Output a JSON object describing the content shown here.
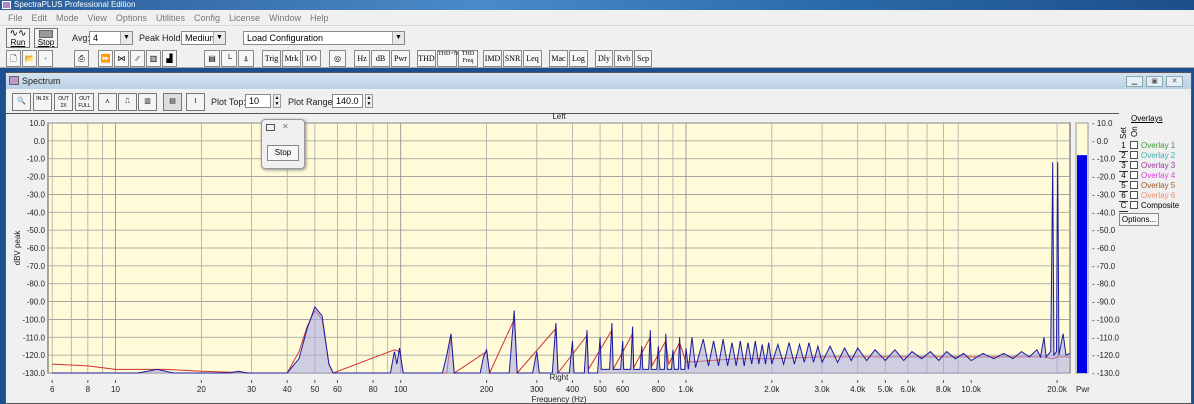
{
  "app": {
    "title": "SpectraPLUS Professional Edition"
  },
  "menu": [
    "File",
    "Edit",
    "Mode",
    "View",
    "Options",
    "Utilities",
    "Config",
    "License",
    "Window",
    "Help"
  ],
  "toolbar": {
    "run_label": "Run",
    "stop_label": "Stop",
    "avg_label": "Avg:",
    "avg_value": "4",
    "peak_hold_label": "Peak Hold:",
    "peak_hold_value": "Medium",
    "config_value": "Load Configuration"
  },
  "toolbar2": {
    "text_buttons": [
      "Trig",
      "Mrk",
      "I/O",
      "Hz",
      "dB",
      "Pwr",
      "THD",
      "THD+N",
      "THD Freq",
      "IMD",
      "SNR",
      "Leq",
      "Mac",
      "Log",
      "Dly",
      "Rvb",
      "Scp"
    ]
  },
  "spectrum_window": {
    "title": "Spectrum",
    "zoom_buttons": [
      "IN 2X",
      "OUT 2X",
      "OUT FULL"
    ],
    "plot_top_label": "Plot Top:",
    "plot_top_value": "10",
    "plot_range_label": "Plot Range:",
    "plot_range_value": "140.0"
  },
  "popup": {
    "stop_label": "Stop"
  },
  "overlays": {
    "title": "Overlays",
    "set_label": "Set",
    "on_label": "On",
    "items": [
      {
        "key": "1",
        "label": "Overlay 1",
        "color": "#3a9a3a"
      },
      {
        "key": "2",
        "label": "Overlay 2",
        "color": "#3ab0b0"
      },
      {
        "key": "3",
        "label": "Overlay 3",
        "color": "#9a3aa0"
      },
      {
        "key": "4",
        "label": "Overlay 4",
        "color": "#e040e0"
      },
      {
        "key": "5",
        "label": "Overlay 5",
        "color": "#9a5a2a"
      },
      {
        "key": "6",
        "label": "Overlay 6",
        "color": "#f0906a"
      },
      {
        "key": "C",
        "label": "Composite",
        "color": "#000000"
      }
    ],
    "options_label": "Options..."
  },
  "chart_data": {
    "type": "line",
    "top_label": "Left",
    "bottom_label": "Right",
    "xlabel": "Frequency (Hz)",
    "ylabel": "dBV peak",
    "xscale": "log",
    "xlim": [
      5.8,
      22200
    ],
    "ylim": [
      -130,
      10
    ],
    "grid": true,
    "yticks": [
      "10.0",
      "0.0",
      "-10.0",
      "-20.0",
      "-30.0",
      "-40.0",
      "-50.0",
      "-60.0",
      "-70.0",
      "-80.0",
      "-90.0",
      "-100.0",
      "-110.0",
      "-120.0",
      "-130.0"
    ],
    "xticks": [
      {
        "v": 6,
        "l": "6"
      },
      {
        "v": 8,
        "l": "8"
      },
      {
        "v": 10,
        "l": "10"
      },
      {
        "v": 20,
        "l": "20"
      },
      {
        "v": 30,
        "l": "30"
      },
      {
        "v": 40,
        "l": "40"
      },
      {
        "v": 50,
        "l": "50"
      },
      {
        "v": 60,
        "l": "60"
      },
      {
        "v": 80,
        "l": "80"
      },
      {
        "v": 100,
        "l": "100"
      },
      {
        "v": 200,
        "l": "200"
      },
      {
        "v": 300,
        "l": "300"
      },
      {
        "v": 400,
        "l": "400"
      },
      {
        "v": 500,
        "l": "500"
      },
      {
        "v": 600,
        "l": "600"
      },
      {
        "v": 800,
        "l": "800"
      },
      {
        "v": 1000,
        "l": "1.0k"
      },
      {
        "v": 2000,
        "l": "2.0k"
      },
      {
        "v": 3000,
        "l": "3.0k"
      },
      {
        "v": 4000,
        "l": "4.0k"
      },
      {
        "v": 5000,
        "l": "5.0k"
      },
      {
        "v": 6000,
        "l": "6.0k"
      },
      {
        "v": 8000,
        "l": "8.0k"
      },
      {
        "v": 10000,
        "l": "10.0k"
      },
      {
        "v": 20000,
        "l": "20.0k"
      }
    ],
    "series": [
      {
        "color": "#1a1aa0",
        "points": [
          [
            6,
            -130
          ],
          [
            12,
            -130
          ],
          [
            14,
            -128
          ],
          [
            16,
            -130
          ],
          [
            25,
            -130
          ],
          [
            27,
            -129
          ],
          [
            29,
            -130
          ],
          [
            40,
            -130
          ],
          [
            44,
            -122
          ],
          [
            47,
            -105
          ],
          [
            50,
            -93
          ],
          [
            53,
            -98
          ],
          [
            56,
            -125
          ],
          [
            58,
            -130
          ],
          [
            92,
            -130
          ],
          [
            95,
            -118
          ],
          [
            97,
            -125
          ],
          [
            99,
            -116
          ],
          [
            102,
            -130
          ],
          [
            140,
            -130
          ],
          [
            145,
            -120
          ],
          [
            150,
            -108
          ],
          [
            154,
            -130
          ],
          [
            190,
            -130
          ],
          [
            195,
            -121
          ],
          [
            200,
            -117
          ],
          [
            205,
            -130
          ],
          [
            240,
            -130
          ],
          [
            250,
            -95
          ],
          [
            256,
            -130
          ],
          [
            290,
            -130
          ],
          [
            300,
            -118
          ],
          [
            306,
            -130
          ],
          [
            340,
            -130
          ],
          [
            350,
            -102
          ],
          [
            356,
            -130
          ],
          [
            390,
            -130
          ],
          [
            400,
            -112
          ],
          [
            405,
            -130
          ],
          [
            440,
            -130
          ],
          [
            450,
            -106
          ],
          [
            455,
            -130
          ],
          [
            490,
            -130
          ],
          [
            500,
            -110
          ],
          [
            505,
            -128
          ],
          [
            540,
            -128
          ],
          [
            550,
            -102
          ],
          [
            556,
            -128
          ],
          [
            590,
            -128
          ],
          [
            600,
            -112
          ],
          [
            605,
            -128
          ],
          [
            640,
            -128
          ],
          [
            650,
            -104
          ],
          [
            656,
            -128
          ],
          [
            690,
            -128
          ],
          [
            700,
            -115
          ],
          [
            706,
            -128
          ],
          [
            740,
            -128
          ],
          [
            750,
            -106
          ],
          [
            756,
            -128
          ],
          [
            790,
            -128
          ],
          [
            800,
            -115
          ],
          [
            810,
            -128
          ],
          [
            840,
            -128
          ],
          [
            850,
            -108
          ],
          [
            860,
            -128
          ],
          [
            890,
            -128
          ],
          [
            900,
            -117
          ],
          [
            910,
            -128
          ],
          [
            940,
            -128
          ],
          [
            950,
            -110
          ],
          [
            960,
            -128
          ],
          [
            990,
            -128
          ],
          [
            1000,
            -116
          ],
          [
            1020,
            -128
          ],
          [
            1050,
            -110
          ],
          [
            1080,
            -127
          ],
          [
            1150,
            -111
          ],
          [
            1200,
            -126
          ],
          [
            1250,
            -112
          ],
          [
            1300,
            -126
          ],
          [
            1350,
            -111
          ],
          [
            1400,
            -126
          ],
          [
            1450,
            -113
          ],
          [
            1500,
            -126
          ],
          [
            1550,
            -112
          ],
          [
            1600,
            -126
          ],
          [
            1650,
            -113
          ],
          [
            1700,
            -125
          ],
          [
            1750,
            -112
          ],
          [
            1800,
            -125
          ],
          [
            1850,
            -114
          ],
          [
            1900,
            -125
          ],
          [
            1950,
            -113
          ],
          [
            2000,
            -125
          ],
          [
            2100,
            -114
          ],
          [
            2200,
            -125
          ],
          [
            2300,
            -113
          ],
          [
            2400,
            -125
          ],
          [
            2500,
            -114
          ],
          [
            2600,
            -124
          ],
          [
            2700,
            -113
          ],
          [
            2800,
            -124
          ],
          [
            2900,
            -115
          ],
          [
            3000,
            -124
          ],
          [
            3200,
            -115
          ],
          [
            3400,
            -124
          ],
          [
            3600,
            -116
          ],
          [
            3800,
            -123
          ],
          [
            4000,
            -116
          ],
          [
            4300,
            -123
          ],
          [
            4600,
            -117
          ],
          [
            5000,
            -123
          ],
          [
            5400,
            -117
          ],
          [
            5800,
            -123
          ],
          [
            6200,
            -118
          ],
          [
            6700,
            -122
          ],
          [
            7200,
            -118
          ],
          [
            7700,
            -123
          ],
          [
            8200,
            -118
          ],
          [
            8800,
            -122
          ],
          [
            9400,
            -119
          ],
          [
            10000,
            -123
          ],
          [
            11000,
            -119
          ],
          [
            12000,
            -122
          ],
          [
            13000,
            -119
          ],
          [
            14000,
            -122
          ],
          [
            15000,
            -118
          ],
          [
            16000,
            -121
          ],
          [
            17000,
            -117
          ],
          [
            17500,
            -121
          ],
          [
            18000,
            -110
          ],
          [
            18300,
            -121
          ],
          [
            19000,
            -118
          ],
          [
            19200,
            -53
          ],
          [
            19300,
            -12
          ],
          [
            19400,
            -63
          ],
          [
            19500,
            -120
          ],
          [
            19900,
            -118
          ],
          [
            20000,
            -53
          ],
          [
            20100,
            -12
          ],
          [
            20200,
            -63
          ],
          [
            20300,
            -120
          ],
          [
            21000,
            -108
          ],
          [
            21500,
            -120
          ],
          [
            22200,
            -119
          ]
        ]
      },
      {
        "color": "#d03030",
        "points": [
          [
            6,
            -125
          ],
          [
            8,
            -126
          ],
          [
            10,
            -128
          ],
          [
            15,
            -128
          ],
          [
            20,
            -129
          ],
          [
            30,
            -130
          ],
          [
            40,
            -130
          ],
          [
            44,
            -118
          ],
          [
            47,
            -104
          ],
          [
            50,
            -95
          ],
          [
            53,
            -100
          ],
          [
            56,
            -125
          ],
          [
            58,
            -130
          ],
          [
            95,
            -117
          ],
          [
            99,
            -118
          ],
          [
            102,
            -130
          ],
          [
            145,
            -130
          ],
          [
            150,
            -110
          ],
          [
            154,
            -130
          ],
          [
            200,
            -118
          ],
          [
            205,
            -130
          ],
          [
            250,
            -100
          ],
          [
            256,
            -130
          ],
          [
            350,
            -105
          ],
          [
            356,
            -130
          ],
          [
            450,
            -109
          ],
          [
            455,
            -128
          ],
          [
            550,
            -106
          ],
          [
            556,
            -128
          ],
          [
            650,
            -108
          ],
          [
            656,
            -127
          ],
          [
            750,
            -110
          ],
          [
            760,
            -126
          ],
          [
            850,
            -112
          ],
          [
            870,
            -125
          ],
          [
            950,
            -113
          ],
          [
            1000,
            -124
          ],
          [
            1500,
            -122
          ],
          [
            2000,
            -122
          ],
          [
            3000,
            -121
          ],
          [
            5000,
            -121
          ],
          [
            8000,
            -121
          ],
          [
            12000,
            -121
          ],
          [
            18000,
            -121
          ],
          [
            19300,
            -122
          ],
          [
            20100,
            -121
          ],
          [
            22200,
            -121
          ]
        ]
      }
    ],
    "power_bar": {
      "label": "Pwr",
      "value_db": -8,
      "ticks": [
        "10.0",
        "0.0",
        "-10.0",
        "-20.0",
        "-30.0",
        "-40.0",
        "-50.0",
        "-60.0",
        "-70.0",
        "-80.0",
        "-90.0",
        "-100.0",
        "-110.0",
        "-120.0",
        "-130.0"
      ]
    }
  }
}
